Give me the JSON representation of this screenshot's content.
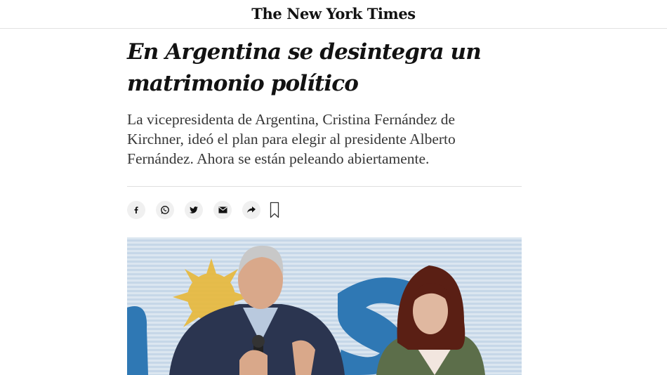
{
  "masthead": {
    "logo_text": "The New York Times"
  },
  "article": {
    "headline": "En Argentina se desintegra un matrimonio político",
    "summary": "La vicepresidenta de Argentina, Cristina Fernández de Kirchner, ideó el plan para elegir al presidente Alberto Fernández. Ahora se están peleando abiertamente."
  },
  "share_bar": {
    "icons": [
      "facebook-icon",
      "whatsapp-icon",
      "twitter-icon",
      "email-icon",
      "share-icon",
      "bookmark-icon"
    ]
  },
  "photo": {
    "subjects": [
      "man-at-microphone",
      "woman-in-green-cardigan"
    ],
    "colors": {
      "background": "#8fb3d4",
      "stripes": "#dbe6f0",
      "sun": "#e8b83a",
      "suit": "#2b3550",
      "cardigan": "#5c6e4a",
      "hair_woman": "#5a1f14"
    }
  }
}
